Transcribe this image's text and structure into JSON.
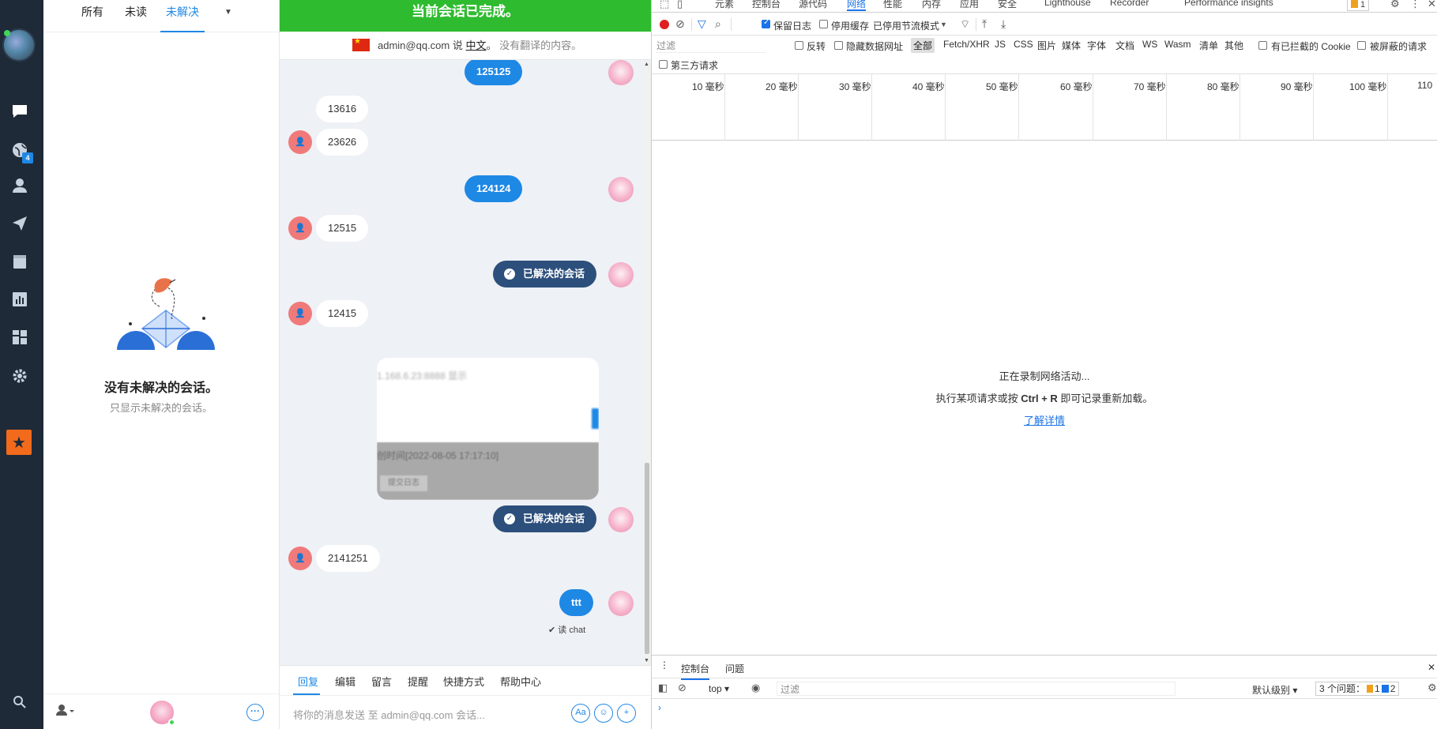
{
  "rail": {
    "badge_count": "4",
    "icons": [
      "chat-icon",
      "globe-icon",
      "person-icon",
      "send-icon",
      "archive-icon",
      "chart-icon",
      "apps-icon",
      "gear-icon",
      "star-icon",
      "search-icon"
    ]
  },
  "list": {
    "tabs": [
      "所有",
      "未读",
      "未解决"
    ],
    "active_tab": "未解决",
    "empty_title": "没有未解决的会话。",
    "empty_subtitle": "只显示未解决的会话。"
  },
  "chat": {
    "banner": "当前会话已完成。",
    "translate": {
      "user": "admin@qq.com",
      "says": "说",
      "language": "中文",
      "note": "没有翻译的内容。"
    },
    "messages": [
      {
        "from": "agent",
        "text": "125125"
      },
      {
        "from": "visitor",
        "text": "13616"
      },
      {
        "from": "visitor",
        "text": "23626"
      },
      {
        "from": "agent",
        "text": "124124"
      },
      {
        "from": "visitor",
        "text": "12515"
      },
      {
        "from": "system",
        "text": "已解决的会话"
      },
      {
        "from": "visitor",
        "text": "12415"
      },
      {
        "from": "system",
        "text": "已解决的会话"
      },
      {
        "from": "visitor",
        "text": "2141251"
      },
      {
        "from": "agent",
        "text": "ttt"
      }
    ],
    "image_msg": {
      "line1": "1.168.6.23:8888 显示",
      "line2": "创时间[2022-08-05 17:17:10]",
      "button": "提交日志"
    },
    "read_receipt": "读 chat",
    "composer_tabs": [
      "回复",
      "编辑",
      "留言",
      "提醒",
      "快捷方式",
      "帮助中心"
    ],
    "active_composer_tab": "回复",
    "composer_placeholder": "将你的消息发送 至 admin@qq.com 会话...",
    "composer_buttons": [
      "Aa",
      "☺",
      "+"
    ]
  },
  "devtools": {
    "tabs": [
      "元素",
      "控制台",
      "源代码",
      "网络",
      "性能",
      "内存",
      "应用",
      "安全",
      "Lighthouse",
      "Recorder",
      "Performance insights"
    ],
    "active_tab": "网络",
    "warn_count": "1",
    "toolbar": {
      "preserve_log": "保留日志",
      "disable_cache": "停用缓存",
      "throttle": "已停用节流模式"
    },
    "filter": {
      "placeholder": "过滤",
      "invert": "反转",
      "hide_data_urls": "隐藏数据网址",
      "types": [
        "全部",
        "Fetch/XHR",
        "JS",
        "CSS",
        "图片",
        "媒体",
        "字体",
        "文档",
        "WS",
        "Wasm",
        "清单",
        "其他"
      ],
      "blocked_cookies": "有已拦截的 Cookie",
      "blocked_requests": "被屏蔽的请求",
      "third_party": "第三方请求"
    },
    "timeline_ticks": [
      "10 毫秒",
      "20 毫秒",
      "30 毫秒",
      "40 毫秒",
      "50 毫秒",
      "60 毫秒",
      "70 毫秒",
      "80 毫秒",
      "90 毫秒",
      "100 毫秒",
      "110"
    ],
    "empty": {
      "line1": "正在录制网络活动...",
      "line2_pre": "执行某项请求或按",
      "line2_key": "Ctrl + R",
      "line2_post": "即可记录重新加载。",
      "link": "了解详情"
    },
    "drawer": {
      "tabs": [
        "控制台",
        "问题"
      ],
      "context": "top",
      "filter_placeholder": "过滤",
      "level": "默认级别",
      "issues_label": "3 个问题：",
      "issues_warn": "1",
      "issues_info": "2"
    }
  }
}
